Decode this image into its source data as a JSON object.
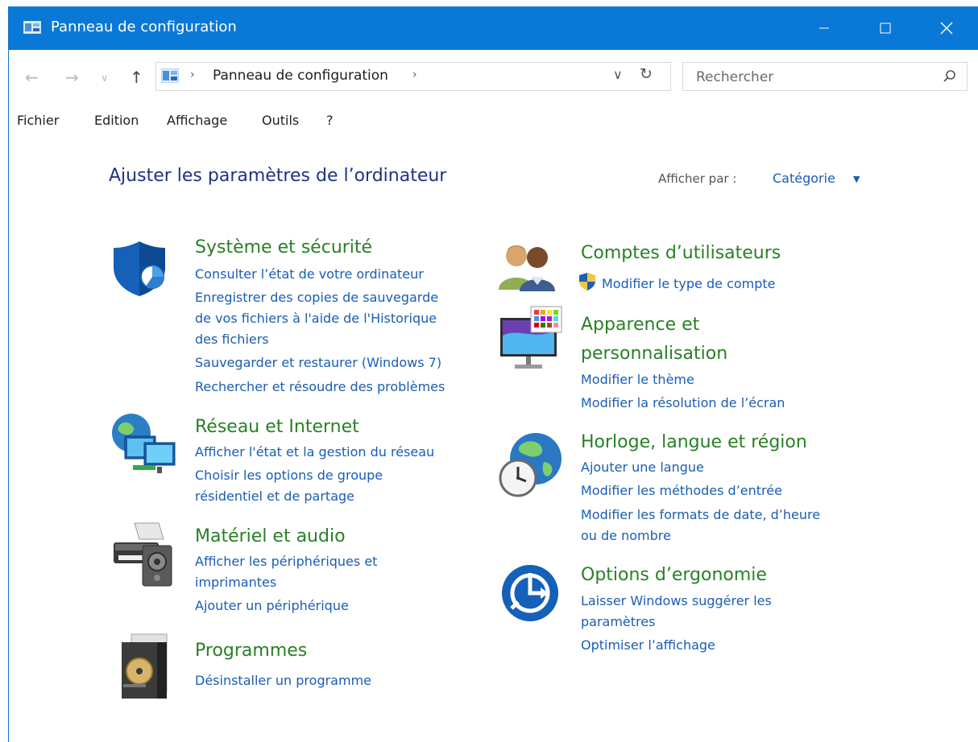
{
  "window": {
    "title": "Panneau de configuration"
  },
  "address": {
    "breadcrumb": "Panneau de configuration"
  },
  "search": {
    "placeholder": "Rechercher"
  },
  "menu": {
    "file": "Fichier",
    "edit": "Edition",
    "view": "Affichage",
    "tools": "Outils",
    "help": "?"
  },
  "page": {
    "title": "Ajuster les paramètres de l’ordinateur",
    "view_by_label": "Afficher par :",
    "view_by_value": "Catégorie"
  },
  "categories": {
    "system": {
      "title": "Système et sécurité",
      "links": [
        "Consulter l’état de votre ordinateur",
        "Enregistrer des copies de sauvegarde",
        "de vos fichiers à l'aide de l'Historique",
        "des fichiers",
        "Sauvegarder et restaurer (Windows 7)",
        "Rechercher et résoudre des problèmes"
      ]
    },
    "network": {
      "title": "Réseau et Internet",
      "links": [
        "Afficher l'état et la gestion du réseau",
        "Choisir les options de groupe",
        "résidentiel et de partage"
      ]
    },
    "hardware": {
      "title": "Matériel et audio",
      "links": [
        "Afficher les périphériques et",
        "imprimantes",
        "Ajouter un périphérique"
      ]
    },
    "programs": {
      "title": "Programmes",
      "links": [
        "Désinstaller un programme"
      ]
    },
    "accounts": {
      "title": "Comptes d’utilisateurs",
      "links": [
        "Modifier le type de compte"
      ]
    },
    "appearance": {
      "title_line1": "Apparence et",
      "title_line2": "personnalisation",
      "links": [
        "Modifier le thème",
        "Modifier la résolution de l’écran"
      ]
    },
    "clock": {
      "title": "Horloge, langue et région",
      "links": [
        "Ajouter une langue",
        "Modifier les méthodes d’entrée",
        "Modifier les formats de date, d’heure",
        "ou de nombre"
      ]
    },
    "ease": {
      "title": "Options d’ergonomie",
      "links": [
        "Laisser Windows suggérer les",
        "paramètres",
        "Optimiser l’affichage"
      ]
    }
  },
  "colors": {
    "titlebar": "#0a78d7",
    "link": "#1a5db4",
    "category": "#298025",
    "heading": "#1e3287"
  }
}
